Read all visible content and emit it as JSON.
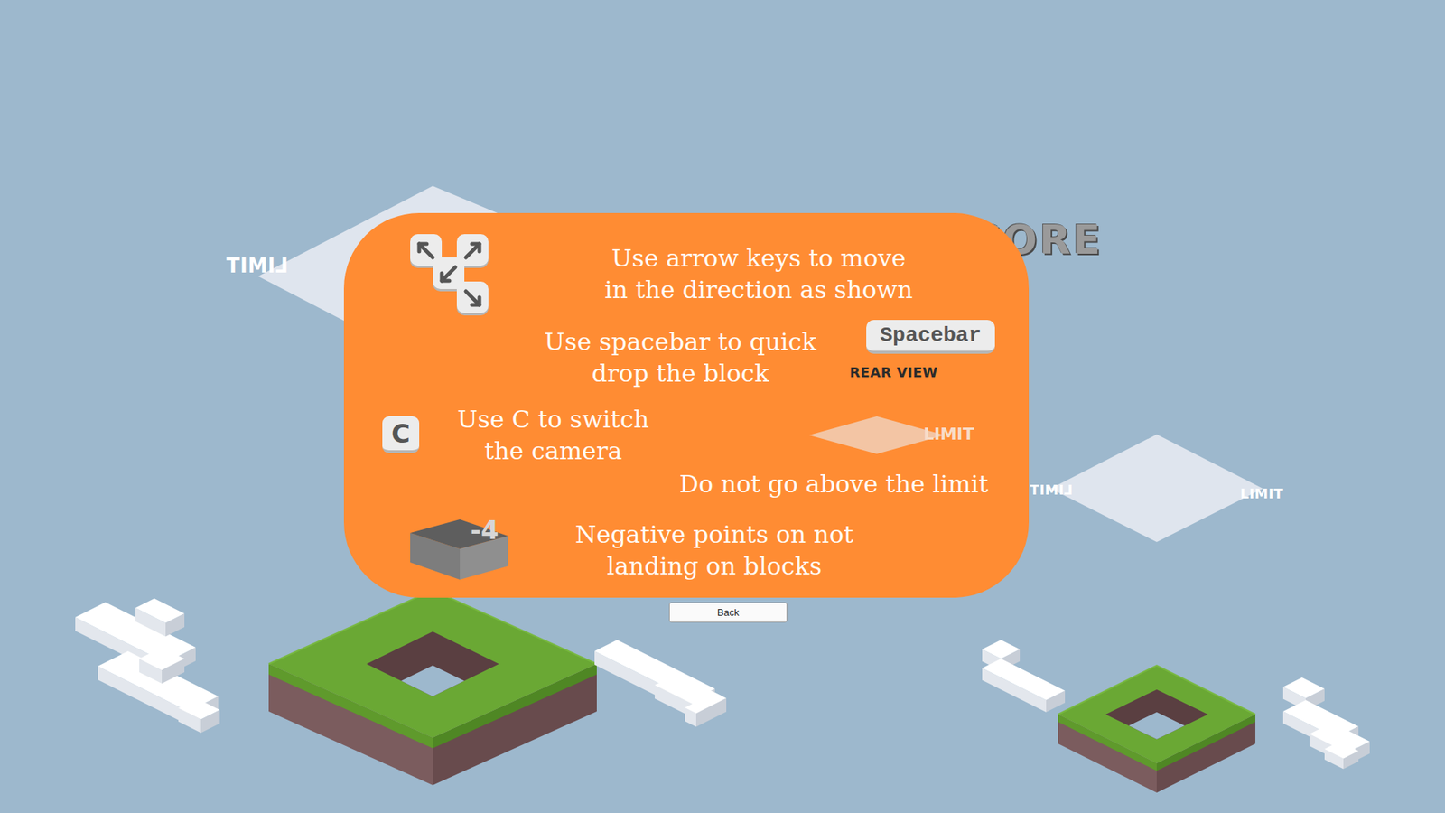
{
  "scene": {
    "score_label": "CORE",
    "rear_view_label": "REAR VIEW",
    "limit_markers": [
      {
        "text": "LIMIT",
        "mirrored": true
      },
      {
        "text": "LIMIT",
        "mirrored": true
      },
      {
        "text": "LIMIT",
        "mirrored": false
      }
    ]
  },
  "help_panel": {
    "move": {
      "lines": [
        "Use arrow keys to move",
        "in the direction as shown"
      ]
    },
    "quick_drop": {
      "lines": [
        "Use spacebar to quick",
        "drop the block"
      ],
      "key": "Spacebar"
    },
    "camera": {
      "lines": [
        "Use C to switch",
        "the camera"
      ],
      "key": "C"
    },
    "limit": {
      "marker": "LIMIT",
      "text": "Do not go above the limit"
    },
    "penalty": {
      "lines": [
        "Negative points on not",
        "landing on blocks"
      ],
      "points": "-4"
    }
  },
  "back_button": {
    "label": "Back"
  }
}
